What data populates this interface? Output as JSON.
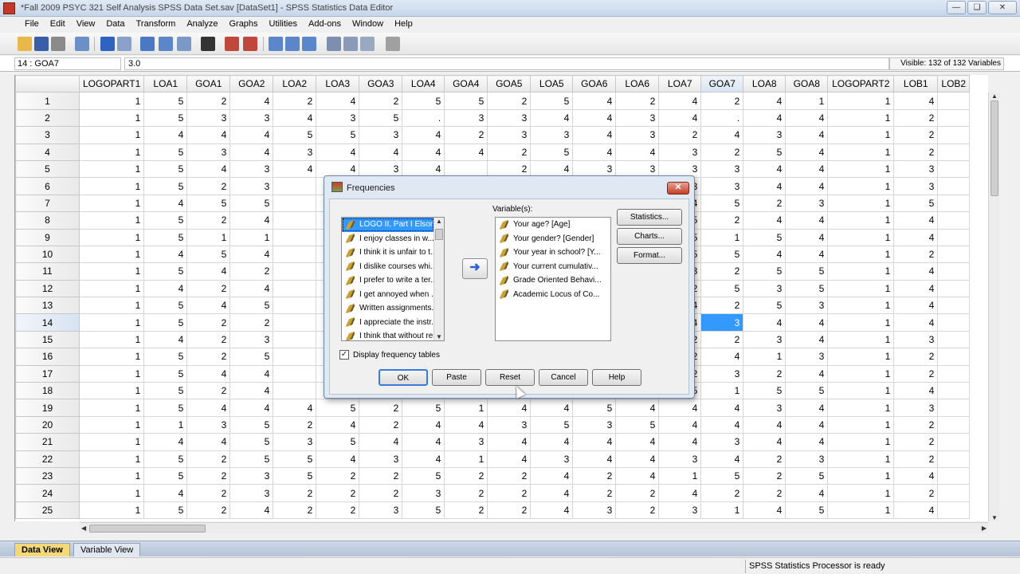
{
  "window": {
    "title": "*Fall 2009 PSYC 321 Self Analysis SPSS Data Set.sav [DataSet1] - SPSS Statistics Data Editor",
    "buttons": [
      "minimize-icon",
      "maximize-icon",
      "close-icon"
    ]
  },
  "menu": [
    "File",
    "Edit",
    "View",
    "Data",
    "Transform",
    "Analyze",
    "Graphs",
    "Utilities",
    "Add-ons",
    "Window",
    "Help"
  ],
  "cellbar": {
    "reference": "14 : GOA7",
    "value": "3.0",
    "visible": "Visible: 132 of 132 Variables"
  },
  "grid": {
    "columns": [
      "LOGOPART1",
      "LOA1",
      "GOA1",
      "GOA2",
      "LOA2",
      "LOA3",
      "GOA3",
      "LOA4",
      "GOA4",
      "GOA5",
      "LOA5",
      "GOA6",
      "LOA6",
      "LOA7",
      "GOA7",
      "LOA8",
      "GOA8",
      "LOGOPART2",
      "LOB1",
      "LOB2"
    ],
    "selected_row": 14,
    "selected_column": "GOA7",
    "rows": [
      [
        "1",
        "5",
        "2",
        "4",
        "2",
        "4",
        "2",
        "5",
        "5",
        "2",
        "5",
        "4",
        "2",
        "4",
        "2",
        "4",
        "1",
        "1",
        "4",
        ""
      ],
      [
        "1",
        "5",
        "3",
        "3",
        "4",
        "3",
        "5",
        ".",
        "3",
        "3",
        "4",
        "4",
        "3",
        "4",
        ".",
        "4",
        "4",
        "1",
        "2",
        ""
      ],
      [
        "1",
        "4",
        "4",
        "4",
        "5",
        "5",
        "3",
        "4",
        "2",
        "3",
        "3",
        "4",
        "3",
        "2",
        "4",
        "3",
        "4",
        "1",
        "2",
        ""
      ],
      [
        "1",
        "5",
        "3",
        "4",
        "3",
        "4",
        "4",
        "4",
        "4",
        "2",
        "5",
        "4",
        "4",
        "3",
        "2",
        "5",
        "4",
        "1",
        "2",
        ""
      ],
      [
        "1",
        "5",
        "4",
        "3",
        "4",
        "4",
        "3",
        "4",
        "",
        "2",
        "4",
        "3",
        "3",
        "3",
        "3",
        "4",
        "4",
        "1",
        "3",
        ""
      ],
      [
        "1",
        "5",
        "2",
        "3",
        "",
        "",
        "",
        "",
        "",
        "",
        "",
        "",
        "",
        "3",
        "3",
        "4",
        "4",
        "1",
        "3",
        ""
      ],
      [
        "1",
        "4",
        "5",
        "5",
        "",
        "",
        "",
        "",
        "",
        "",
        "",
        "",
        "",
        "4",
        "5",
        "2",
        "3",
        "1",
        "5",
        ""
      ],
      [
        "1",
        "5",
        "2",
        "4",
        "",
        "",
        "",
        "",
        "",
        "",
        "",
        "",
        "",
        "5",
        "2",
        "4",
        "4",
        "1",
        "4",
        ""
      ],
      [
        "1",
        "5",
        "1",
        "1",
        "",
        "",
        "",
        "",
        "",
        "",
        "",
        "",
        "",
        "5",
        "1",
        "5",
        "4",
        "1",
        "4",
        ""
      ],
      [
        "1",
        "4",
        "5",
        "4",
        "",
        "",
        "",
        "",
        "",
        "",
        "",
        "",
        "",
        "5",
        "5",
        "4",
        "4",
        "1",
        "2",
        ""
      ],
      [
        "1",
        "5",
        "4",
        "2",
        "",
        "",
        "",
        "",
        "",
        "",
        "",
        "",
        "",
        "3",
        "2",
        "5",
        "5",
        "1",
        "4",
        ""
      ],
      [
        "1",
        "4",
        "2",
        "4",
        "",
        "",
        "",
        "",
        "",
        "",
        "",
        "",
        "",
        "2",
        "5",
        "3",
        "5",
        "1",
        "4",
        ""
      ],
      [
        "1",
        "5",
        "4",
        "5",
        "",
        "",
        "",
        "",
        "",
        "",
        "",
        "",
        "",
        "4",
        "2",
        "5",
        "3",
        "1",
        "4",
        ""
      ],
      [
        "1",
        "5",
        "2",
        "2",
        "",
        "",
        "",
        "",
        "",
        "",
        "",
        "",
        "",
        "4",
        "3",
        "4",
        "4",
        "1",
        "4",
        ""
      ],
      [
        "1",
        "4",
        "2",
        "3",
        "",
        "",
        "",
        "",
        "",
        "",
        "",
        "",
        "",
        "2",
        "2",
        "3",
        "4",
        "1",
        "3",
        ""
      ],
      [
        "1",
        "5",
        "2",
        "5",
        "",
        "",
        "",
        "",
        "",
        "",
        "",
        "",
        "",
        "2",
        "4",
        "1",
        "3",
        "1",
        "2",
        ""
      ],
      [
        "1",
        "5",
        "4",
        "4",
        "",
        "",
        "",
        "",
        "",
        "",
        "",
        "",
        "",
        "2",
        "3",
        "2",
        "4",
        "1",
        "2",
        ""
      ],
      [
        "1",
        "5",
        "2",
        "4",
        "",
        "",
        "",
        "",
        "",
        "",
        "",
        "",
        "",
        "5",
        "1",
        "5",
        "5",
        "1",
        "4",
        ""
      ],
      [
        "1",
        "5",
        "4",
        "4",
        "4",
        "5",
        "2",
        "5",
        "1",
        "4",
        "4",
        "5",
        "4",
        "4",
        "4",
        "3",
        "4",
        "1",
        "3",
        ""
      ],
      [
        "1",
        "1",
        "3",
        "5",
        "2",
        "4",
        "2",
        "4",
        "4",
        "3",
        "5",
        "3",
        "5",
        "4",
        "4",
        "4",
        "4",
        "1",
        "2",
        ""
      ],
      [
        "1",
        "4",
        "4",
        "5",
        "3",
        "5",
        "4",
        "4",
        "3",
        "4",
        "4",
        "4",
        "4",
        "4",
        "3",
        "4",
        "4",
        "1",
        "2",
        ""
      ],
      [
        "1",
        "5",
        "2",
        "5",
        "5",
        "4",
        "3",
        "4",
        "1",
        "4",
        "3",
        "4",
        "4",
        "3",
        "4",
        "2",
        "3",
        "1",
        "2",
        ""
      ],
      [
        "1",
        "5",
        "2",
        "3",
        "5",
        "2",
        "2",
        "5",
        "2",
        "2",
        "4",
        "2",
        "4",
        "1",
        "5",
        "2",
        "5",
        "1",
        "4",
        ""
      ],
      [
        "1",
        "4",
        "2",
        "3",
        "2",
        "2",
        "2",
        "3",
        "2",
        "2",
        "4",
        "2",
        "2",
        "4",
        "2",
        "2",
        "4",
        "1",
        "2",
        ""
      ],
      [
        "1",
        "5",
        "2",
        "4",
        "2",
        "2",
        "3",
        "5",
        "2",
        "2",
        "4",
        "3",
        "2",
        "3",
        "1",
        "4",
        "5",
        "1",
        "4",
        ""
      ]
    ]
  },
  "tabs": {
    "data_view": "Data View",
    "variable_view": "Variable View"
  },
  "status": "SPSS Statistics  Processor is ready",
  "dialog": {
    "title": "Frequencies",
    "source_items": [
      "LOGO II, Part I Elson,...",
      "I enjoy classes in w...",
      "I think it is unfair to t...",
      "I dislike courses whi...",
      "I prefer to write a ter...",
      "I get annoyed when ...",
      "Written assignments...",
      "I appreciate the instr...",
      "I think that without re..."
    ],
    "variables_label": "Variable(s):",
    "variables": [
      "Your age? [Age]",
      "Your gender? [Gender]",
      "Your year in school? [Y...",
      "Your current cumulativ...",
      "Grade Oriented Behavi...",
      "Academic Locus of Co..."
    ],
    "buttons": {
      "statistics": "Statistics...",
      "charts": "Charts...",
      "format": "Format...",
      "ok": "OK",
      "paste": "Paste",
      "reset": "Reset",
      "cancel": "Cancel",
      "help": "Help"
    },
    "checkbox_label": "Display frequency tables",
    "checkbox_checked": true
  }
}
